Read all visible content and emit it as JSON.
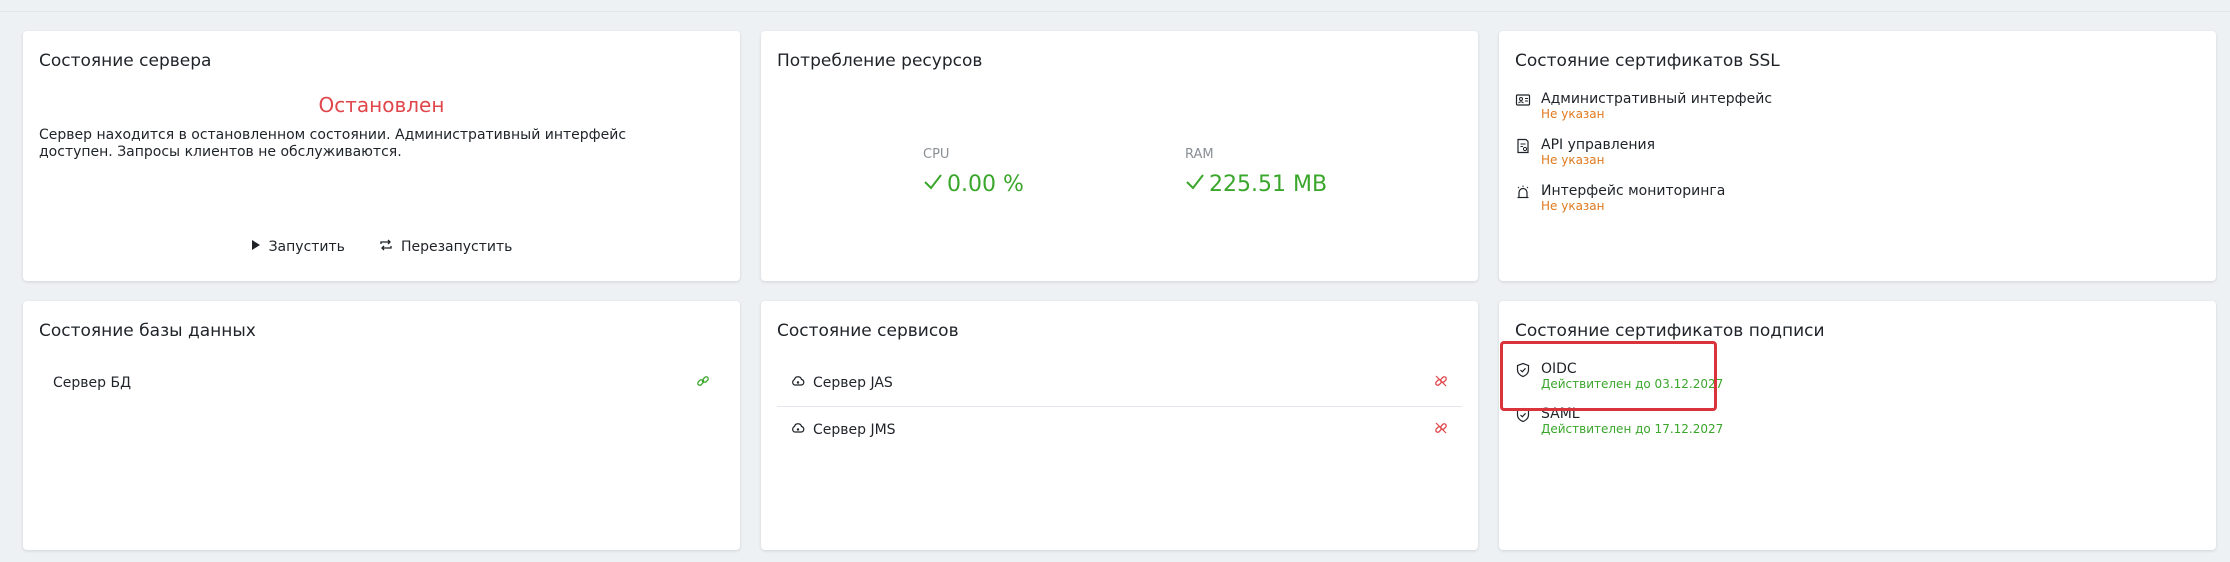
{
  "colors": {
    "stopped": "#e0464b",
    "ok": "#3aa62b",
    "warn": "#e07a1f",
    "link_ok": "#3aa62b",
    "link_broken": "#e0464b",
    "highlight": "#d9343b"
  },
  "server_card": {
    "title": "Состояние сервера",
    "status": "Остановлен",
    "description": "Сервер находится в остановленном состоянии. Административный интерфейс доступен. Запросы клиентов не обслуживаются.",
    "start_label": "Запустить",
    "restart_label": "Перезапустить"
  },
  "resources_card": {
    "title": "Потребление ресурсов",
    "cpu": {
      "label": "CPU",
      "value": "0.00 %"
    },
    "ram": {
      "label": "RAM",
      "value": "225.51 MB"
    }
  },
  "ssl_card": {
    "title": "Состояние сертификатов SSL",
    "items": [
      {
        "name": "Административный интерфейс",
        "status": "Не указан",
        "icon": "admin-interface-icon"
      },
      {
        "name": "API управления",
        "status": "Не указан",
        "icon": "api-doc-icon"
      },
      {
        "name": "Интерфейс мониторинга",
        "status": "Не указан",
        "icon": "alarm-icon"
      }
    ]
  },
  "db_card": {
    "title": "Состояние базы данных",
    "items": [
      {
        "name": "Сервер БД",
        "icon": "link-icon"
      }
    ]
  },
  "services_card": {
    "title": "Состояние сервисов",
    "items": [
      {
        "name": "Сервер JAS",
        "icon": "broken-link-icon"
      },
      {
        "name": "Сервер JMS",
        "icon": "broken-link-icon"
      }
    ]
  },
  "signing_card": {
    "title": "Состояние сертификатов подписи",
    "items": [
      {
        "name": "OIDC",
        "status": "Действителен до 03.12.2027",
        "icon": "shield-check-icon"
      },
      {
        "name": "SAML",
        "status": "Действителен до 17.12.2027",
        "icon": "shield-check-icon"
      }
    ]
  }
}
